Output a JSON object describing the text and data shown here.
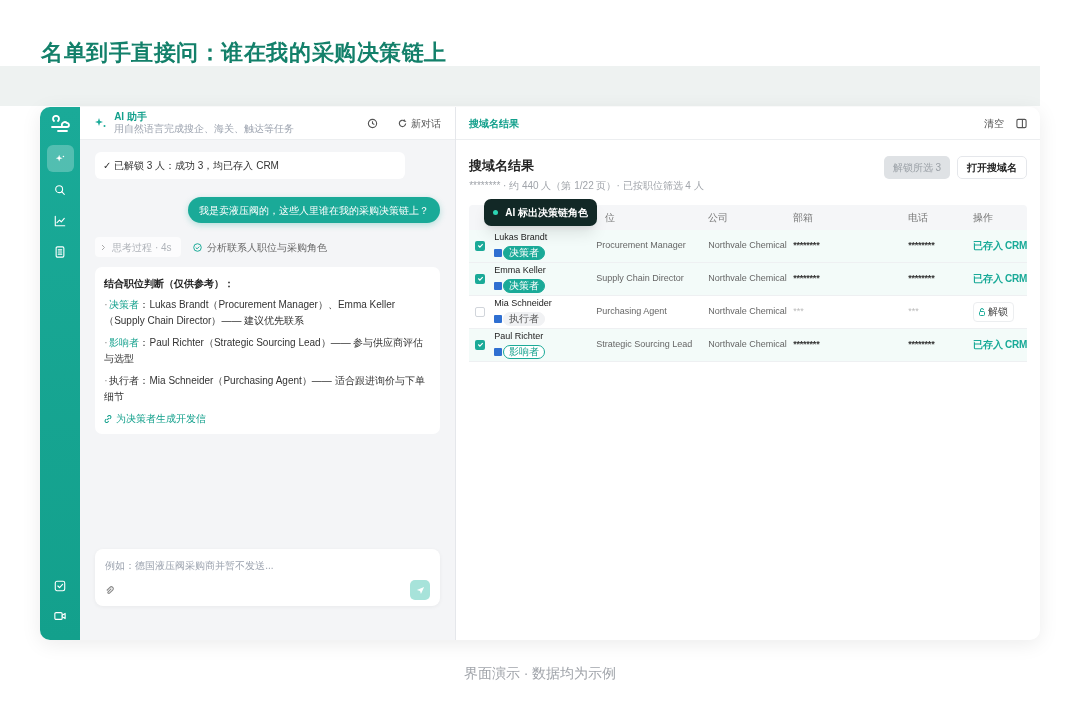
{
  "headline": "名单到手直接问：谁在我的采购决策链上",
  "sidebar": {
    "items": [
      {
        "selected": true
      },
      {
        "selected": false
      },
      {
        "selected": false
      },
      {
        "selected": false
      }
    ]
  },
  "assistant": {
    "title": "AI 助手",
    "subtitle": "用自然语言完成搜企、海关、触达等任务",
    "new_chat": "新对话",
    "messages": [
      {
        "kind": "status",
        "text": "✓ 已解锁 3 人：成功 3，均已存入 CRM"
      },
      {
        "kind": "user",
        "text": "我是卖液压阀的，这些人里谁在我的采购决策链上？"
      },
      {
        "kind": "thinking",
        "text": "思考过程 · 4s",
        "step": "分析联系人职位与采购角色"
      },
      {
        "kind": "answer",
        "title": "结合职位判断（仅供参考）：",
        "lines": [
          {
            "bullet": "·",
            "role": "决策者",
            "highlight": true,
            "text": "：Lukas Brandt（Procurement Manager）、Emma Keller（Supply Chain Director）—— 建议优先联系"
          },
          {
            "bullet": "·",
            "role": "影响者",
            "highlight": true,
            "text": "：Paul Richter（Strategic Sourcing Lead）—— 参与供应商评估与选型"
          },
          {
            "bullet": "·",
            "role": "执行者",
            "highlight": false,
            "text": "：Mia Schneider（Purchasing Agent）—— 适合跟进询价与下单细节"
          }
        ],
        "link": "为决策者生成开发信"
      }
    ],
    "input": {
      "placeholder": "例如：德国液压阀采购商并暂不发送..."
    }
  },
  "results": {
    "tab": "搜域名结果",
    "clear": "清空",
    "title": "搜域名结果",
    "summary": "******** · 约 440 人（第 1/22 页）· 已按职位筛选 4 人",
    "unlock_selected": "解锁所选 3",
    "open": "打开搜域名",
    "tooltip": "AI 标出决策链角色",
    "columns": [
      "位",
      "公司",
      "部箱",
      "电话",
      "操作"
    ],
    "rows": [
      {
        "selected": true,
        "name": "Lukas Brandt",
        "role": {
          "kind": "decision",
          "text": "决策者"
        },
        "title": "Procurement Manager",
        "company": "Northvale Chemical",
        "email": "********",
        "phone": "********",
        "action": {
          "kind": "saved",
          "text": "已存入 CRM"
        }
      },
      {
        "selected": true,
        "name": "Emma Keller",
        "role": {
          "kind": "decision",
          "text": "决策者"
        },
        "title": "Supply Chain Director",
        "company": "Northvale Chemical",
        "email": "********",
        "phone": "********",
        "action": {
          "kind": "saved",
          "text": "已存入 CRM"
        }
      },
      {
        "selected": false,
        "name": "Mia Schneider",
        "role": {
          "kind": "executor",
          "text": "执行者"
        },
        "title": "Purchasing Agent",
        "company": "Northvale Chemical",
        "email": "***",
        "phone": "***",
        "action": {
          "kind": "unlock",
          "text": "解锁"
        }
      },
      {
        "selected": true,
        "name": "Paul Richter",
        "role": {
          "kind": "influencer",
          "text": "影响者"
        },
        "title": "Strategic Sourcing Lead",
        "company": "Northvale Chemical",
        "email": "********",
        "phone": "********",
        "action": {
          "kind": "saved",
          "text": "已存入 CRM"
        }
      }
    ]
  },
  "footer": "界面演示 · 数据均为示例"
}
